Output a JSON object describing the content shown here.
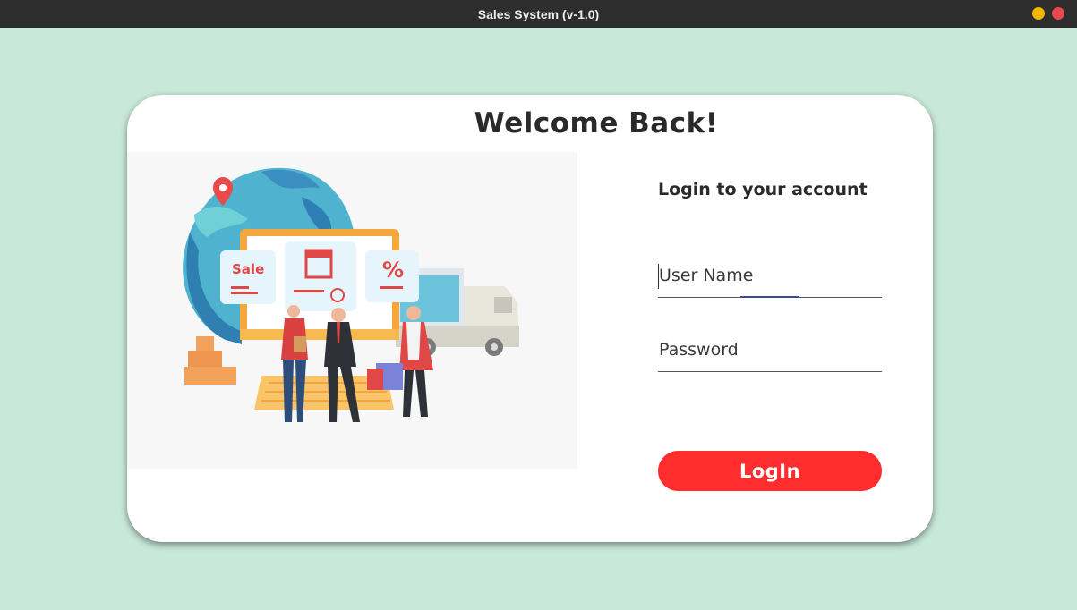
{
  "window": {
    "title": "Sales System (v-1.0)"
  },
  "card": {
    "heading": "Welcome Back!",
    "illustration": {
      "tag_sale": "Sale",
      "tag_percent": "%"
    },
    "form": {
      "heading": "Login to your account",
      "username_placeholder": "User Name",
      "password_placeholder": "Password",
      "login_label": "LogIn"
    }
  },
  "colors": {
    "background": "#c8e8da",
    "titlebar": "#2d2d2d",
    "login_button": "#ff2d2d",
    "minimize": "#f4b400",
    "close": "#e5484d"
  }
}
